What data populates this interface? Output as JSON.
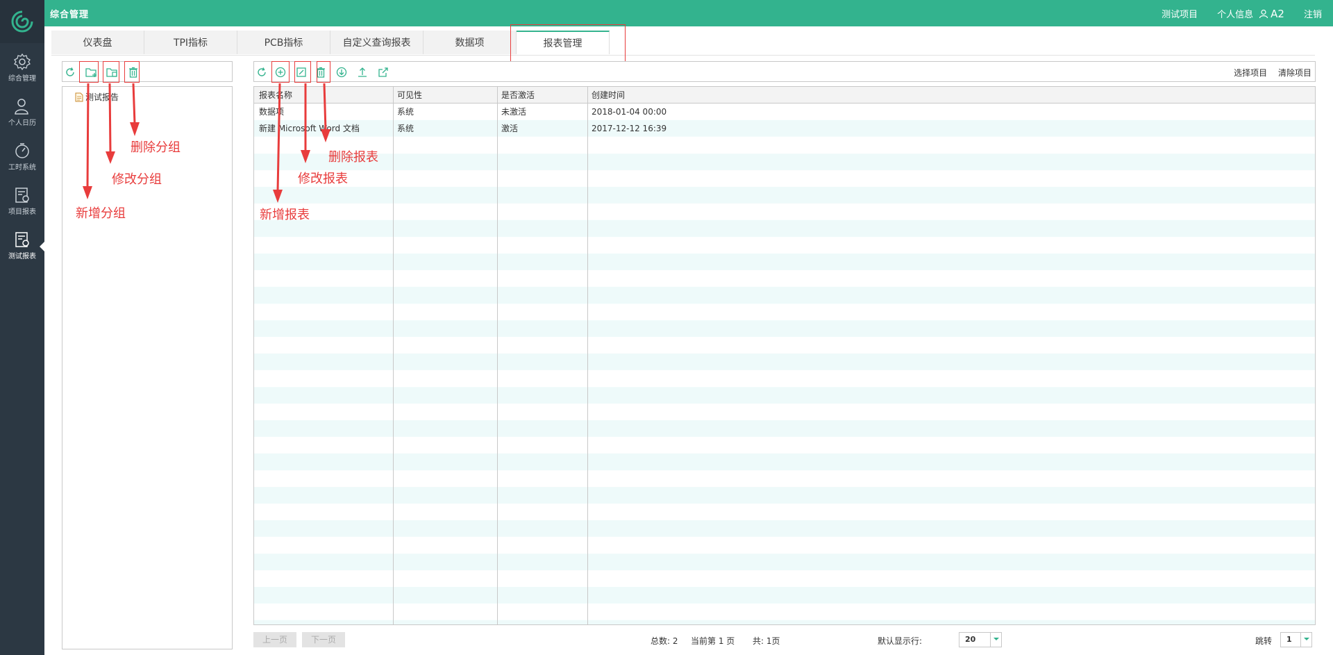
{
  "header": {
    "app_title": "综合管理",
    "links": [
      "测试项目",
      "个人信息"
    ],
    "user": "A2",
    "logout": "注销"
  },
  "nav": [
    {
      "label": "综合管理",
      "icon": "gear-icon"
    },
    {
      "label": "个人日历",
      "icon": "person-icon"
    },
    {
      "label": "工时系统",
      "icon": "stopwatch-icon"
    },
    {
      "label": "项目报表",
      "icon": "report-icon"
    },
    {
      "label": "测试报表",
      "icon": "report-icon",
      "active": true
    }
  ],
  "tabs": [
    "仪表盘",
    "TPI指标",
    "PCB指标",
    "自定义查询报表",
    "数据项",
    "报表管理"
  ],
  "active_tab": "报表管理",
  "tree": {
    "nodes": [
      "测试报告"
    ]
  },
  "toolbar_right": {
    "select_items": "选择项目",
    "clear_items": "清除项目"
  },
  "table": {
    "columns": [
      "报表名称",
      "可见性",
      "是否激活",
      "创建时间"
    ],
    "rows": [
      [
        "数据项",
        "系统",
        "未激活",
        "2018-01-04 00:00"
      ],
      [
        "新建 Microsoft Word 文档",
        "系统",
        "激活",
        "2017-12-12 16:39"
      ]
    ]
  },
  "pager": {
    "prev": "上一页",
    "next": "下一页",
    "total": "总数: 2",
    "current": "当前第 1 页",
    "pages": "共: 1页",
    "rows_label": "默认显示行:",
    "rows_value": "20",
    "jump_label": "跳转",
    "jump_value": "1"
  },
  "annotations": {
    "add_group": "新增分组",
    "edit_group": "修改分组",
    "delete_group": "删除分组",
    "add_report": "新增报表",
    "edit_report": "修改报表",
    "delete_report": "删除报表"
  },
  "colors": {
    "accent": "#33b38e",
    "nav_bg": "#2c3843",
    "annotation": "#e83c3c"
  }
}
